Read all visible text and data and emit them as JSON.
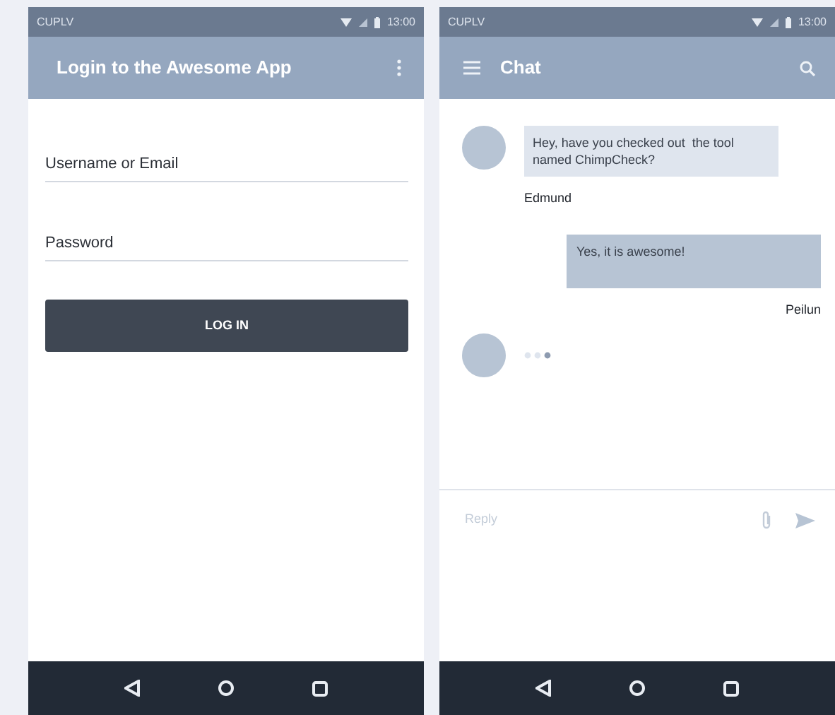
{
  "login_screen": {
    "status_bar": {
      "carrier": "CUPLV",
      "time": "13:00"
    },
    "app_bar": {
      "title": "Login to the Awesome App"
    },
    "fields": [
      {
        "placeholder": "Username or Email"
      },
      {
        "placeholder": "Password"
      }
    ],
    "button": "LOG IN"
  },
  "chat_screen": {
    "status_bar": {
      "carrier": "CUPLV",
      "time": "13:00"
    },
    "app_bar": {
      "title": "Chat"
    },
    "messages": [
      {
        "kind": "incoming",
        "text": "Hey, have you checked out  the tool named ChimpCheck?",
        "sender": "Edmund"
      },
      {
        "kind": "outgoing",
        "text": "Yes, it is awesome!",
        "sender": "Peilun"
      },
      {
        "kind": "typing"
      }
    ],
    "composer": {
      "placeholder": "Reply"
    }
  }
}
